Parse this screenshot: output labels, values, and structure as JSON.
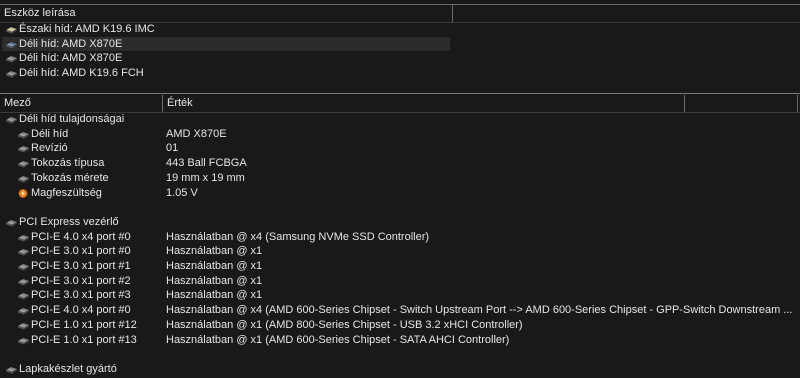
{
  "device_panel": {
    "header": "Eszköz leírása",
    "items": [
      {
        "label": "Északi híd: AMD K19.6 IMC",
        "icon": "northbridge-chip-icon",
        "selected": false
      },
      {
        "label": "Déli híd: AMD X870E",
        "icon": "southbridge-chip-icon",
        "selected": true
      },
      {
        "label": "Déli híd: AMD X870E",
        "icon": "southbridge-chip-icon",
        "selected": false
      },
      {
        "label": "Déli híd: AMD K19.6 FCH",
        "icon": "southbridge-chip-icon",
        "selected": false
      }
    ]
  },
  "details": {
    "columns": {
      "field": "Mező",
      "value": "Érték"
    },
    "sections": [
      {
        "title": "Déli híd tulajdonságai",
        "rows": [
          {
            "field": "Déli híd",
            "value": "AMD X870E",
            "icon": "chip-icon"
          },
          {
            "field": "Revízió",
            "value": "01",
            "icon": "chip-icon"
          },
          {
            "field": "Tokozás típusa",
            "value": "443 Ball FCBGA",
            "icon": "chip-icon"
          },
          {
            "field": "Tokozás mérete",
            "value": "19 mm x 19 mm",
            "icon": "chip-icon"
          },
          {
            "field": "Magfeszültség",
            "value": "1.05 V",
            "icon": "voltage-icon"
          }
        ]
      },
      {
        "title": "PCI Express vezérlő",
        "rows": [
          {
            "field": "PCI-E 4.0 x4 port #0",
            "value": "Használatban @ x4  (Samsung NVMe SSD Controller)",
            "icon": "chip-icon"
          },
          {
            "field": "PCI-E 3.0 x1 port #0",
            "value": "Használatban @ x1",
            "icon": "chip-icon"
          },
          {
            "field": "PCI-E 3.0 x1 port #1",
            "value": "Használatban @ x1",
            "icon": "chip-icon"
          },
          {
            "field": "PCI-E 3.0 x1 port #2",
            "value": "Használatban @ x1",
            "icon": "chip-icon"
          },
          {
            "field": "PCI-E 3.0 x1 port #3",
            "value": "Használatban @ x1",
            "icon": "chip-icon"
          },
          {
            "field": "PCI-E 4.0 x4 port #0",
            "value": "Használatban @ x4  (AMD 600-Series Chipset - Switch Upstream Port --> AMD 600-Series Chipset - GPP-Switch Downstream ...",
            "icon": "chip-icon"
          },
          {
            "field": "PCI-E 1.0 x1 port #12",
            "value": "Használatban @ x1  (AMD 800-Series Chipset - USB 3.2 xHCI Controller)",
            "icon": "chip-icon"
          },
          {
            "field": "PCI-E 1.0 x1 port #13",
            "value": "Használatban @ x1  (AMD 600-Series Chipset - SATA AHCI Controller)",
            "icon": "chip-icon"
          }
        ]
      },
      {
        "title": "Lapkakészlet gyártó",
        "rows": []
      }
    ]
  },
  "colors": {
    "background": "#191919",
    "text": "#e6e6e6",
    "selection": "#2c2c2c",
    "grid": "#5a5a5a"
  }
}
